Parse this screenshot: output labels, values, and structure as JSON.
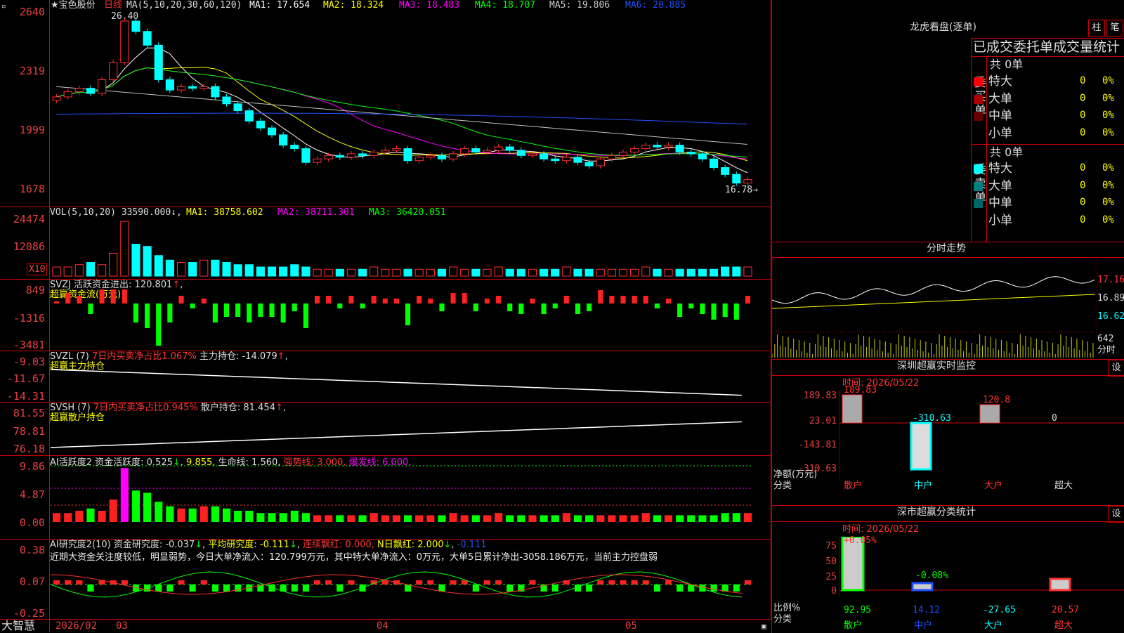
{
  "kline": {
    "name": "宝色股份",
    "period": "日线",
    "ma_params": "MA(5,10,20,30,60,120)",
    "ma": [
      {
        "label": "MA1: 17.654",
        "color": "#ffffff"
      },
      {
        "label": "MA2: 18.324",
        "color": "#ffff00"
      },
      {
        "label": "MA3: 18.483",
        "color": "#ff00ff"
      },
      {
        "label": "MA4: 18.707",
        "color": "#00ff00"
      },
      {
        "label": "MA5: 19.806",
        "color": "#c0c0c0"
      },
      {
        "label": "MA6: 20.885",
        "color": "#0040ff"
      }
    ],
    "high_label": "26.40",
    "low_label": "16.78",
    "yticks": [
      "2640",
      "2319",
      "1999",
      "1678"
    ]
  },
  "vol": {
    "title": "VOL(5,10,20)",
    "value": "33590.000",
    "ma": [
      {
        "label": "MA1: 38758.602",
        "color": "#ffff00"
      },
      {
        "label": "MA2: 38711.301",
        "color": "#ff00ff"
      },
      {
        "label": "MA3: 36420.051",
        "color": "#00ff00"
      }
    ],
    "yticks": [
      "24474",
      "12086"
    ],
    "unit": "X10"
  },
  "svzj": {
    "title": "SVZJ",
    "line1": "活跃资金进出: 120.801",
    "line2": "超赢资金流(万元)",
    "yticks": [
      "849",
      "-1316",
      "-3481"
    ]
  },
  "svzl": {
    "title": "SVZL (7)",
    "ratio": "7日内买卖净占比1.067%",
    "hold": "主力持仓: -14.079",
    "sub": "超赢主力持仓",
    "yticks": [
      "-9.03",
      "-11.67",
      "-14.31"
    ]
  },
  "svsh": {
    "title": "SVSH (7)",
    "ratio": "7日内买卖净占比0.945%",
    "hold": "散户持仓: 81.454",
    "sub": "超赢散户持仓",
    "yticks": [
      "81.55",
      "78.81",
      "76.18"
    ]
  },
  "ai1": {
    "title": "AI活跃度2",
    "a": "资金活跃度: 0.525",
    "b": "9.855,",
    "c": "生命线: 1.560,",
    "d": "强势线: 3.000,",
    "e": "爆发线: 6.000,",
    "yticks": [
      "9.86",
      "4.87",
      "0.00"
    ]
  },
  "ai2": {
    "title": "AI研究度2(10)",
    "a": "资金研究度: -0.037",
    "b": "平均研究度: -0.111",
    "c": "连续飘红: 0.000,",
    "d": "N日飘红: 2.000",
    "e": "-0.111",
    "comment": "近期大资金关注度较低，明显弱势，今日大单净流入：120.799万元，其中特大单净流入：0万元，大单5日累计净出-3058.186万元，当前主力控盘弱",
    "yticks": [
      "0.38",
      "0.07",
      "-0.25"
    ]
  },
  "xaxis": {
    "labels": [
      "2026/02",
      "03",
      "04",
      "05"
    ],
    "brand": "大智慧"
  },
  "lhb": {
    "title": "龙虎看盘(逐单)",
    "btn1": "柱",
    "btn2": "笔",
    "header": "已成交委托单成交量统计",
    "buy": {
      "label": "委买单",
      "total": "共 0单",
      "rows": [
        {
          "name": "特大",
          "v": "0",
          "p": "0%",
          "color": "#ff0000"
        },
        {
          "name": "大单",
          "v": "0",
          "p": "0%",
          "color": "#aa0000"
        },
        {
          "name": "中单",
          "v": "0",
          "p": "0%",
          "color": "#660000"
        },
        {
          "name": "小单",
          "v": "0",
          "p": "0%",
          "color": "#000000"
        }
      ]
    },
    "sell": {
      "label": "委卖单",
      "total": "共 0单",
      "rows": [
        {
          "name": "特大",
          "v": "0",
          "p": "0%",
          "color": "#00ffff"
        },
        {
          "name": "大单",
          "v": "0",
          "p": "0%",
          "color": "#008080"
        },
        {
          "name": "中单",
          "v": "0",
          "p": "0%",
          "color": "#006666"
        },
        {
          "name": "小单",
          "v": "0",
          "p": "0%",
          "color": "#000000"
        }
      ]
    }
  },
  "fenshi": {
    "title": "分时走势",
    "yticks": [
      "17.16",
      "16.89",
      "16.62"
    ],
    "vtick": "642",
    "unit": "分时"
  },
  "monitor": {
    "title": "深圳超赢实时监控",
    "btn": "设",
    "time": "时间: 2026/05/22",
    "yticks": [
      "189.83",
      "23.01",
      "-143.81",
      "-310.63"
    ],
    "ylabel": "净额(万元)",
    "xlabel": "分类",
    "cats": [
      "散户",
      "中户",
      "大户",
      "超大"
    ],
    "vals": [
      "189.83",
      "-310.63",
      "120.8",
      "0"
    ]
  },
  "classify": {
    "title": "深市超赢分类统计",
    "btn": "设",
    "time": "时间: 2026/05/22",
    "yticks": [
      "75",
      "50",
      "25",
      "0"
    ],
    "ylabel": "比例%",
    "xlabel": "分类",
    "cats": [
      "散户",
      "中户",
      "大户",
      "超大"
    ],
    "top": [
      "+0.05%",
      "-0.08%"
    ],
    "vals": [
      "92.95",
      "14.12",
      "-27.65",
      "20.57"
    ]
  },
  "chart_data": {
    "type": "candlestick",
    "kline_yrange": [
      16.78,
      26.4
    ],
    "closes": [
      22.0,
      22.3,
      22.5,
      22.2,
      23.0,
      24.0,
      26.4,
      25.8,
      25.0,
      23.0,
      22.4,
      22.6,
      22.5,
      22.6,
      22.0,
      21.6,
      21.2,
      20.6,
      20.2,
      19.8,
      19.2,
      19.0,
      18.2,
      18.4,
      18.6,
      18.5,
      18.7,
      18.6,
      18.8,
      18.9,
      19.0,
      18.3,
      18.5,
      18.6,
      18.4,
      18.7,
      19.0,
      18.8,
      18.9,
      19.1,
      18.9,
      18.6,
      18.7,
      18.4,
      18.3,
      18.5,
      18.2,
      18.0,
      18.4,
      18.6,
      18.8,
      19.0,
      19.2,
      19.1,
      19.2,
      18.8,
      18.7,
      18.4,
      17.9,
      17.5,
      17.0,
      17.2
    ],
    "vol": [
      4,
      4,
      5,
      6,
      5,
      10,
      24,
      14,
      13,
      9,
      7,
      6,
      6,
      7,
      7,
      6,
      5,
      5,
      4,
      4,
      4,
      5,
      4,
      3,
      3,
      3,
      3,
      3,
      4,
      3,
      3,
      3,
      3,
      3,
      3,
      4,
      3,
      3,
      3,
      4,
      3,
      3,
      3,
      3,
      3,
      4,
      3,
      3,
      3,
      3,
      3,
      3,
      4,
      3,
      3,
      3,
      3,
      3,
      3,
      4,
      4,
      4
    ]
  }
}
